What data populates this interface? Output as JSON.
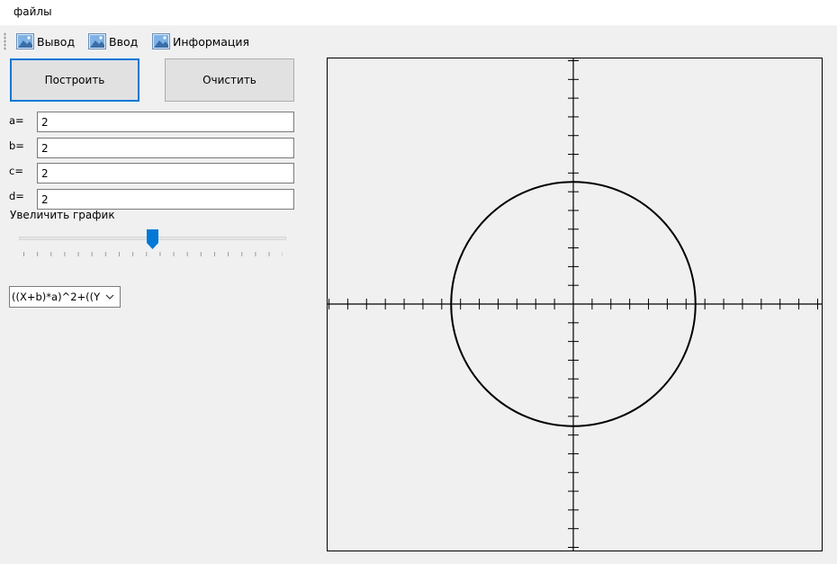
{
  "menubar": {
    "files": "файлы"
  },
  "toolbar": {
    "output": "Вывод",
    "input": "Ввод",
    "info": "Информация"
  },
  "buttons": {
    "build": "Построить",
    "clear": "Очистить"
  },
  "params": [
    {
      "label": "a=",
      "value": "2"
    },
    {
      "label": "b=",
      "value": "2"
    },
    {
      "label": "c=",
      "value": "2"
    },
    {
      "label": "d=",
      "value": "2"
    }
  ],
  "zoom": {
    "label": "Увеличить график",
    "slider_fraction": 0.5
  },
  "formula_select": {
    "selected": "((X+b)*a)^2+((Y"
  },
  "graph": {
    "ticks_per_half_x": 13,
    "ticks_per_half_y": 13,
    "circle_radius_ticks": 6.5
  },
  "colors": {
    "focus": "#0078d7",
    "accent": "#0078d7"
  }
}
